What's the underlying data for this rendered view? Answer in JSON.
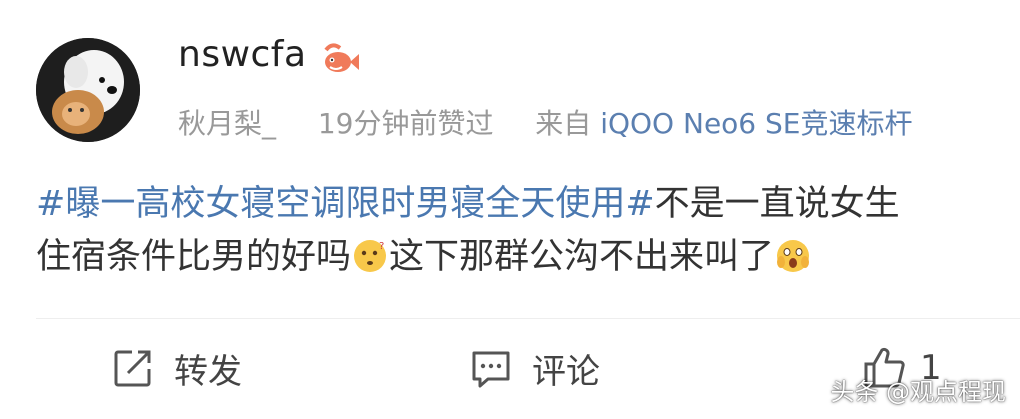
{
  "post": {
    "username": "nswcfa",
    "liker": "秋月梨_",
    "time_action": "19分钟前赞过",
    "source_prefix": "来自",
    "device": "iQOO Neo6 SE竞速标杆",
    "topic": "#曝一高校女寝空调限时男寝全天使用#",
    "text_line1": "不是一直说女生",
    "text_line2a": "住宿条件比男的好吗",
    "text_line2b": "这下那群公沟不出来叫了",
    "emoji1": "thinking-face-icon",
    "emoji2": "screaming-face-icon"
  },
  "actions": {
    "repost_label": "转发",
    "comment_label": "评论",
    "like_count": "1"
  },
  "watermark": "头条 @观点程现",
  "colors": {
    "topic": "#4a78b0",
    "meta": "#999999",
    "device": "#5b7fb0"
  }
}
